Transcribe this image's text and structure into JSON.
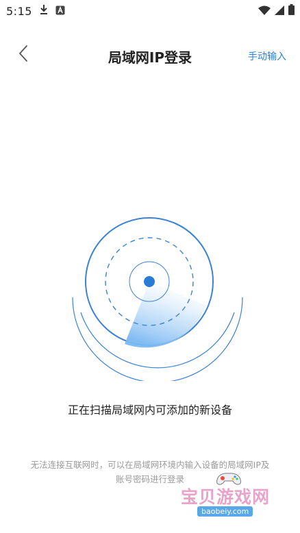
{
  "status_bar": {
    "time": "5:15",
    "icons": [
      "download-icon",
      "notification-a-icon",
      "wifi-icon",
      "signal-icon",
      "battery-icon"
    ]
  },
  "header": {
    "title": "局域网IP登录",
    "manual_input": "手动输入",
    "back_icon": "chevron-left-icon"
  },
  "main": {
    "scanning_text": "正在扫描局域网内可添加的新设备",
    "hint": "无法连接互联网时，可以在局域网环境内输入设备的局域网IP及账号密码进行登录"
  },
  "watermark": {
    "text": "宝贝游戏网",
    "sub": "baobeiy.com"
  },
  "colors": {
    "accent": "#2f7fd8",
    "radar_blue": "#3b82d6",
    "text_primary": "#222222",
    "text_hint": "#9a9a9a"
  }
}
